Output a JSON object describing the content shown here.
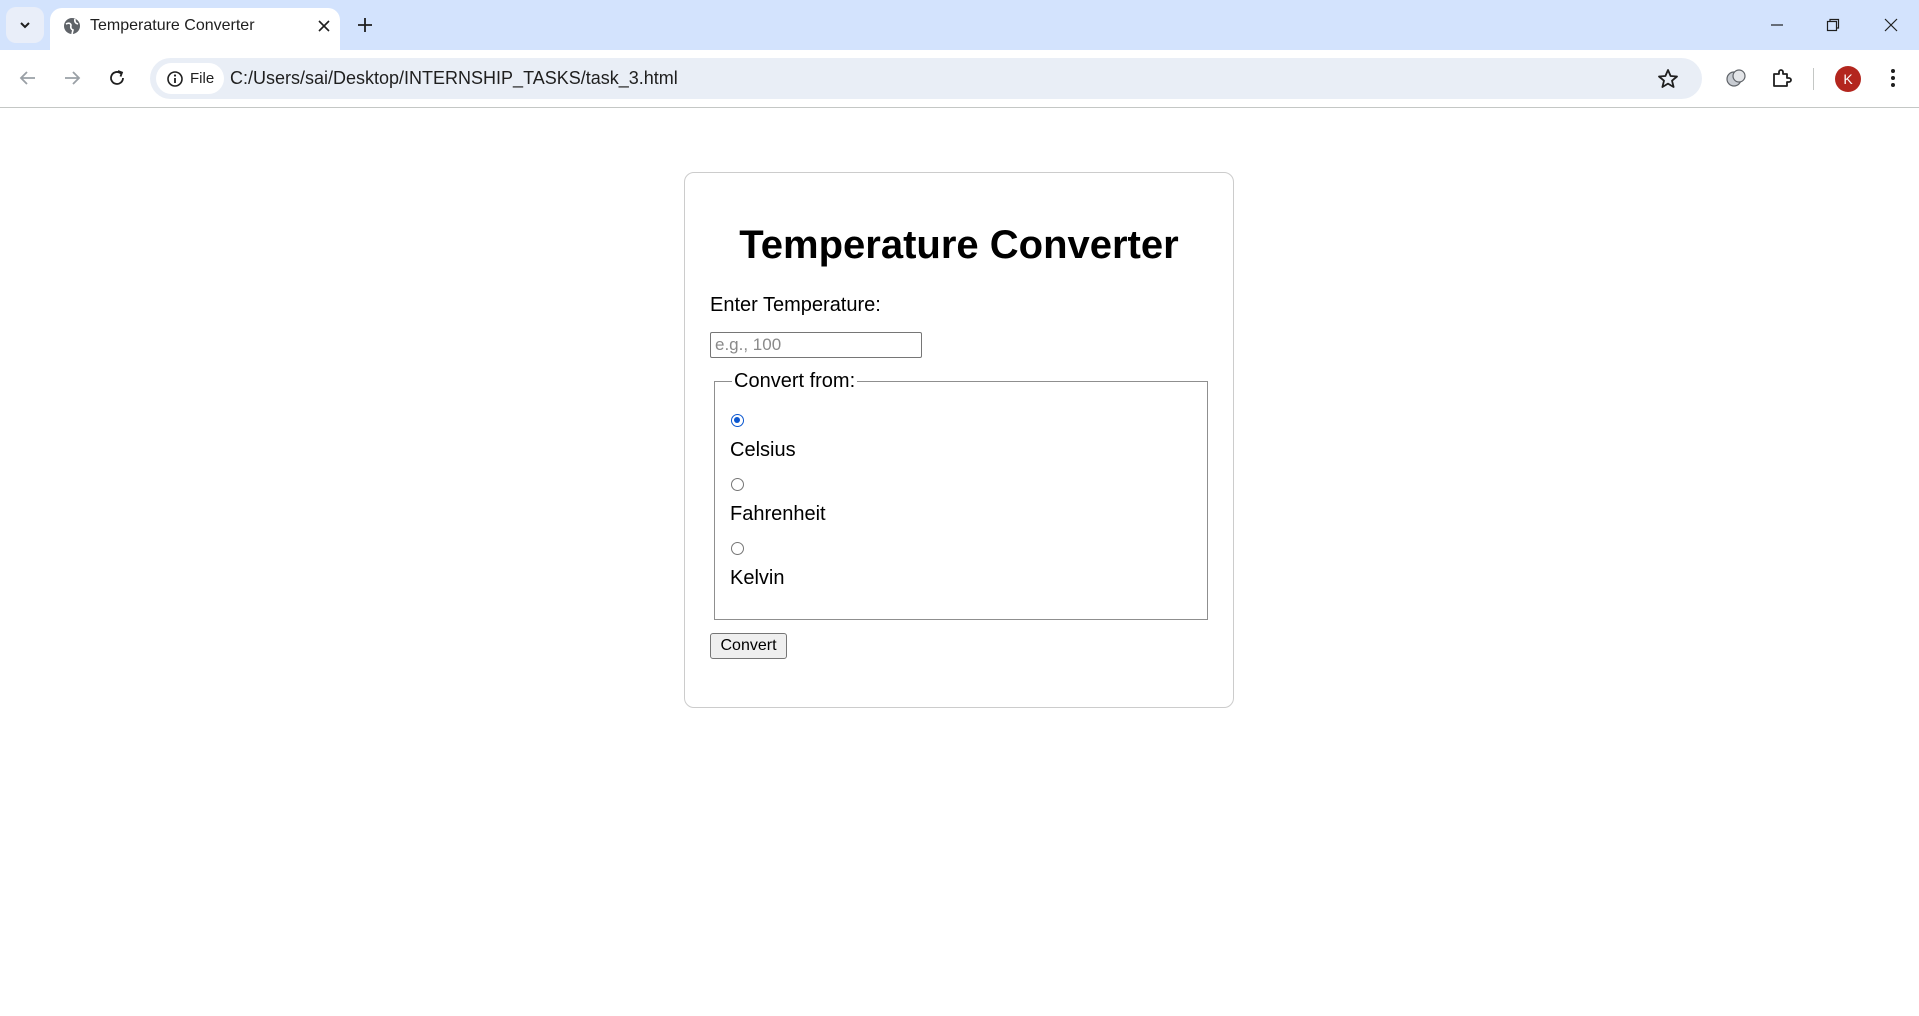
{
  "browser": {
    "tab": {
      "title": "Temperature Converter"
    },
    "address": {
      "scheme_chip": "File",
      "url": "C:/Users/sai/Desktop/INTERNSHIP_TASKS/task_3.html"
    },
    "profile_initial": "K",
    "colors": {
      "tabstrip": "#d3e3fd",
      "omnibox": "#e9eef6",
      "avatar": "#b3261e",
      "accent": "#0b57d0"
    }
  },
  "page": {
    "heading": "Temperature Converter",
    "input_label": "Enter Temperature:",
    "input": {
      "value": "",
      "placeholder": "e.g., 100"
    },
    "fieldset_legend": "Convert from:",
    "units": [
      {
        "label": "Celsius",
        "checked": true
      },
      {
        "label": "Fahrenheit",
        "checked": false
      },
      {
        "label": "Kelvin",
        "checked": false
      }
    ],
    "convert_button": "Convert"
  }
}
